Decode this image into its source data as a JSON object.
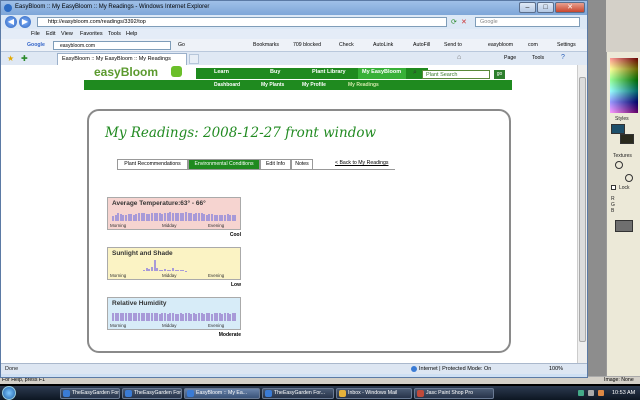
{
  "psp": {
    "panel": {
      "styles_label": "Styles",
      "textures_label": "Textures",
      "lock_label": "Lock",
      "rgb_labels": [
        "R",
        "G",
        "B"
      ]
    },
    "status_help": "For Help, press F1",
    "image_label": "Image: None"
  },
  "ie": {
    "title": "EasyBloom :: My EasyBloom :: My Readings - Windows Internet Explorer",
    "address": "http://easybloom.com/readings/3392/top",
    "search_placeholder": "Google",
    "menu": [
      "File",
      "Edit",
      "View",
      "Favorites",
      "Tools",
      "Help"
    ],
    "google_toolbar": {
      "label": "Google",
      "search_value": "easybloom.com",
      "go": "Go",
      "items": [
        "Bookmarks",
        "709 blocked",
        "Check",
        "AutoLink",
        "AutoFill",
        "Send to",
        "easybloom",
        "com",
        "Settings"
      ]
    },
    "tab_title": "EasyBloom :: My EasyBloom :: My Readings",
    "tab_tools": [
      "Page",
      "Tools"
    ],
    "status": {
      "text": "Done",
      "zone": "Internet | Protected Mode: On",
      "zoom": "100%"
    }
  },
  "site": {
    "logo": "easyBloom",
    "nav": [
      "Learn",
      "Buy",
      "Plant Library",
      "My EasyBloom"
    ],
    "search_placeholder": "Plant Search",
    "go": "go",
    "subnav": [
      "Dashboard",
      "My Plants",
      "My Profile",
      "My Readings"
    ],
    "page_title": "My Readings: 2008-12-27 front window",
    "tabs": [
      "Plant Recommendations",
      "Environmental Conditions",
      "Edit Info",
      "Notes"
    ],
    "active_tab": 1,
    "back_link": "< Back to My Readings",
    "graphs": [
      {
        "title": "Average Temperature:63° - 66°",
        "label": "Cool",
        "bg": "#f6d4d0",
        "bars_color": "#a89ad8",
        "levels": [
          0.35,
          0.45,
          0.55,
          0.5,
          0.45,
          0.4,
          0.5,
          0.5,
          0.45,
          0.5,
          0.55,
          0.6,
          0.55,
          0.5,
          0.5,
          0.55,
          0.6,
          0.6,
          0.55,
          0.5,
          0.55,
          0.6,
          0.65,
          0.6,
          0.55,
          0.6,
          0.55,
          0.6,
          0.65,
          0.6,
          0.55,
          0.5,
          0.55,
          0.6,
          0.55,
          0.5,
          0.45,
          0.5,
          0.5,
          0.45,
          0.4,
          0.45,
          0.4,
          0.45,
          0.5,
          0.45,
          0.4,
          0.45
        ],
        "x": [
          "Morning",
          "Midday",
          "Evening"
        ]
      },
      {
        "title": "Sunlight and Shade",
        "label": "Low",
        "bg": "#fbf3c4",
        "bars_color": "#a89ad8",
        "levels": [
          0,
          0,
          0,
          0,
          0,
          0,
          0,
          0,
          0,
          0,
          0,
          0,
          0.1,
          0.2,
          0.15,
          0.3,
          0.8,
          0.25,
          0.1,
          0.05,
          0.15,
          0.1,
          0.05,
          0.2,
          0.1,
          0.05,
          0.08,
          0.05,
          0.03,
          0,
          0,
          0,
          0,
          0,
          0,
          0,
          0,
          0,
          0,
          0,
          0,
          0,
          0,
          0,
          0,
          0,
          0,
          0
        ],
        "x": [
          "Morning",
          "Midday",
          "Evening"
        ]
      },
      {
        "title": "Relative Humidity",
        "label": "Moderate",
        "bg": "#d7ecf8",
        "bars_color": "#a89ad8",
        "levels": [
          0.55,
          0.55,
          0.6,
          0.6,
          0.55,
          0.55,
          0.6,
          0.55,
          0.55,
          0.6,
          0.55,
          0.55,
          0.6,
          0.55,
          0.55,
          0.6,
          0.55,
          0.55,
          0.5,
          0.55,
          0.55,
          0.5,
          0.55,
          0.55,
          0.5,
          0.5,
          0.55,
          0.5,
          0.55,
          0.55,
          0.5,
          0.55,
          0.5,
          0.55,
          0.55,
          0.5,
          0.55,
          0.55,
          0.5,
          0.55,
          0.55,
          0.55,
          0.5,
          0.55,
          0.55,
          0.5,
          0.55,
          0.55
        ],
        "x": [
          "Morning",
          "Midday",
          "Evening"
        ]
      }
    ]
  },
  "taskbar": {
    "buttons": [
      {
        "label": "TheEasyGarden For...",
        "icon_color": "#3a7bd5"
      },
      {
        "label": "TheEasyGarden For...",
        "icon_color": "#3a7bd5"
      },
      {
        "label": "EasyBloom :: My Ea...",
        "icon_color": "#3a7bd5",
        "active": true
      },
      {
        "label": "TheEasyGarden For...",
        "icon_color": "#3a7bd5"
      },
      {
        "label": "Inbox - Windows Mail",
        "icon_color": "#e6b23a"
      },
      {
        "label": "Jasc Paint Shop Pro",
        "icon_color": "#c04a3a"
      }
    ],
    "clock": "10:53 AM"
  }
}
